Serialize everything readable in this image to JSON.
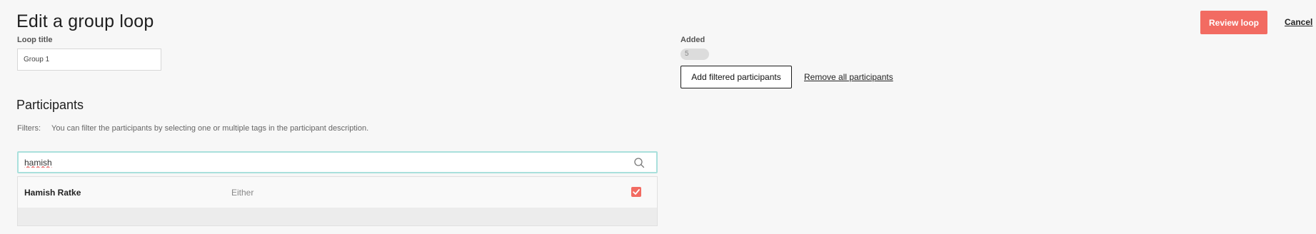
{
  "header": {
    "title": "Edit a group loop",
    "review_label": "Review loop",
    "cancel_label": "Cancel"
  },
  "loop_title": {
    "label": "Loop title",
    "value": "Group 1"
  },
  "added": {
    "label": "Added",
    "count": "5"
  },
  "actions": {
    "add_filtered_label": "Add filtered participants",
    "remove_all_label": "Remove all participants"
  },
  "participants": {
    "section_title": "Participants",
    "filters_label": "Filters:",
    "filters_hint": "You can filter the participants by selecting one or multiple tags in the participant description.",
    "search_value": "hamish",
    "results": [
      {
        "name": "Hamish Ratke",
        "type": "Either",
        "checked": true
      }
    ]
  },
  "colors": {
    "accent": "#f26b62",
    "search_border": "#a9e0dc",
    "background": "#f7f7f7"
  },
  "icons": {
    "search": "search-icon",
    "check": "check-icon"
  }
}
